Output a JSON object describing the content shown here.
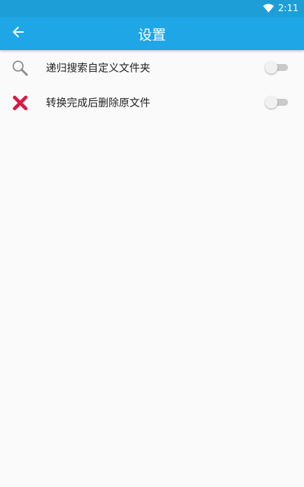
{
  "status_bar": {
    "time": "2:11",
    "icons": [
      "wifi-icon"
    ]
  },
  "app_bar": {
    "title": "设置",
    "back_icon": "arrow-left-icon"
  },
  "settings": [
    {
      "icon": "magnifier-icon",
      "label": "递归搜索自定义文件夹",
      "enabled": false
    },
    {
      "icon": "red-cross-icon",
      "label": "转换完成后删除原文件",
      "enabled": false
    }
  ],
  "colors": {
    "app_bar": "#1ea6e6",
    "status_bar": "#1e9ed6",
    "background": "#fafafa",
    "cross": "#d81b4a"
  }
}
